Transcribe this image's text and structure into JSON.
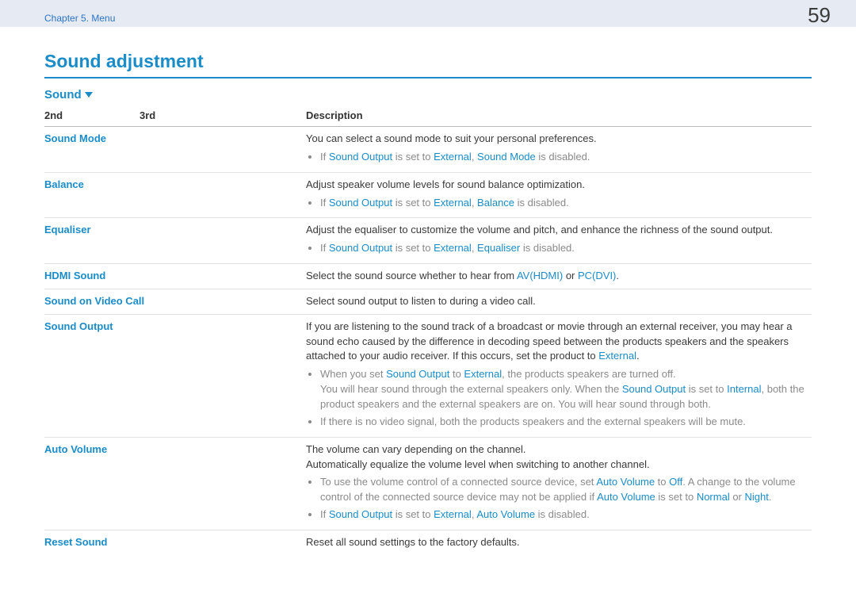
{
  "header": {
    "breadcrumb": "Chapter 5. Menu",
    "page_number": "59"
  },
  "section": {
    "title": "Sound adjustment",
    "sub": "Sound"
  },
  "table": {
    "headers": {
      "c2nd": "2nd",
      "c3rd": "3rd",
      "cdesc": "Description"
    },
    "rows": {
      "sound_mode": {
        "name": "Sound Mode",
        "desc": "You can select a sound mode to suit your personal preferences.",
        "note_pre": "If ",
        "note_so": "Sound Output",
        "note_mid": " is set to ",
        "note_ext": "External",
        "note_comma": ", ",
        "note_sm": "Sound Mode",
        "note_post": " is disabled."
      },
      "balance": {
        "name": "Balance",
        "desc": "Adjust speaker volume levels for sound balance optimization.",
        "note_pre": "If ",
        "note_so": "Sound Output",
        "note_mid": " is set to ",
        "note_ext": "External",
        "note_comma": ", ",
        "note_bal": "Balance",
        "note_post": " is disabled."
      },
      "equaliser": {
        "name": "Equaliser",
        "desc": "Adjust the equaliser to customize the volume and pitch, and enhance the richness of the sound output.",
        "note_pre": "If ",
        "note_so": "Sound Output",
        "note_mid": " is set to ",
        "note_ext": "External",
        "note_comma": ", ",
        "note_eq": "Equaliser",
        "note_post": " is disabled."
      },
      "hdmi": {
        "name": "HDMI Sound",
        "desc_pre": "Select the sound source whether to hear from ",
        "av": "AV(HDMI)",
        "or": " or ",
        "pc": "PC(DVI)",
        "dot": "."
      },
      "svc": {
        "name": "Sound on Video Call",
        "desc": "Select sound output to listen to during a video call."
      },
      "sout": {
        "name": "Sound Output",
        "p1a": "If you are listening to the sound track of a broadcast or movie through an external receiver, you may hear a sound echo caused by the difference in decoding speed between the products speakers and the speakers attached to your audio receiver. If this occurs, set the product to ",
        "p1ext": "External",
        "p1dot": ".",
        "b1a": "When you set ",
        "b1so": "Sound Output",
        "b1b": " to ",
        "b1ext": "External",
        "b1c": ", the products speakers are turned off.",
        "b1d": "You will hear sound through the external speakers only. When the ",
        "b1so2": "Sound Output",
        "b1e": " is set to ",
        "b1int": "Internal",
        "b1f": ", both the product speakers and the external speakers are on. You will hear sound through both.",
        "b2": "If there is no video signal, both the products speakers and the external speakers will be mute."
      },
      "av": {
        "name": "Auto Volume",
        "p1": "The volume can vary depending on the channel.",
        "p2": "Automatically equalize the volume level when switching to another channel.",
        "b1a": "To use the volume control of a connected source device, set ",
        "b1_av": "Auto Volume",
        "b1b": " to ",
        "b1_off": "Off",
        "b1c": ". A change to the volume control of the connected source device may not be applied if ",
        "b1_av2": "Auto Volume",
        "b1d": " is set to ",
        "b1_norm": "Normal",
        "b1e": " or ",
        "b1_night": "Night",
        "b1f": ".",
        "b2a": "If ",
        "b2_so": "Sound Output",
        "b2b": " is set to ",
        "b2_ext": "External",
        "b2c": ", ",
        "b2_av": "Auto Volume",
        "b2d": " is disabled."
      },
      "reset": {
        "name": "Reset Sound",
        "desc": "Reset all sound settings to the factory defaults."
      }
    }
  }
}
